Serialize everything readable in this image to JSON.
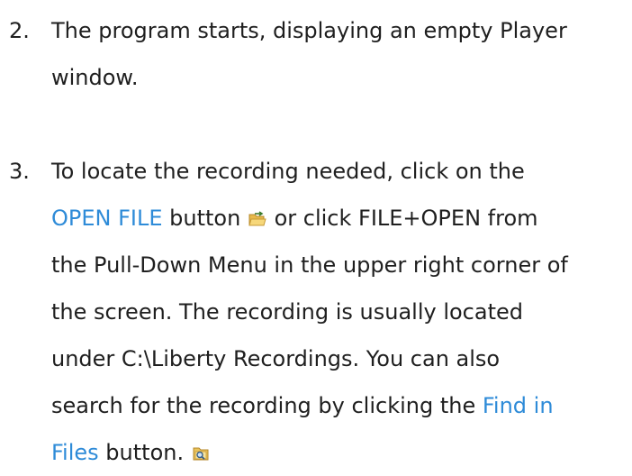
{
  "steps": [
    {
      "number": "2.",
      "lines": [
        "The program starts, displaying an empty Player",
        "window."
      ]
    },
    {
      "number": "3.",
      "line1": "To locate the recording needed, click on the",
      "open_file_link": "OPEN FILE",
      "line2_mid": " button ",
      "line2_end": " or click FILE+OPEN from",
      "line3": "the Pull-Down Menu in the upper right corner of",
      "line4": "the screen.  The recording is usually located",
      "line5": "under C:\\Liberty Recordings.  You can also",
      "line6_start": "search for the recording by clicking the ",
      "find_in_link_part1": "Find in",
      "find_in_link_part2": "Files",
      "line7_end": " button. "
    }
  ],
  "icons": {
    "open_file": "open-folder-icon",
    "find_in_files": "find-in-files-icon"
  },
  "colors": {
    "text": "#1f1f1f",
    "link": "#2e8bd8"
  }
}
